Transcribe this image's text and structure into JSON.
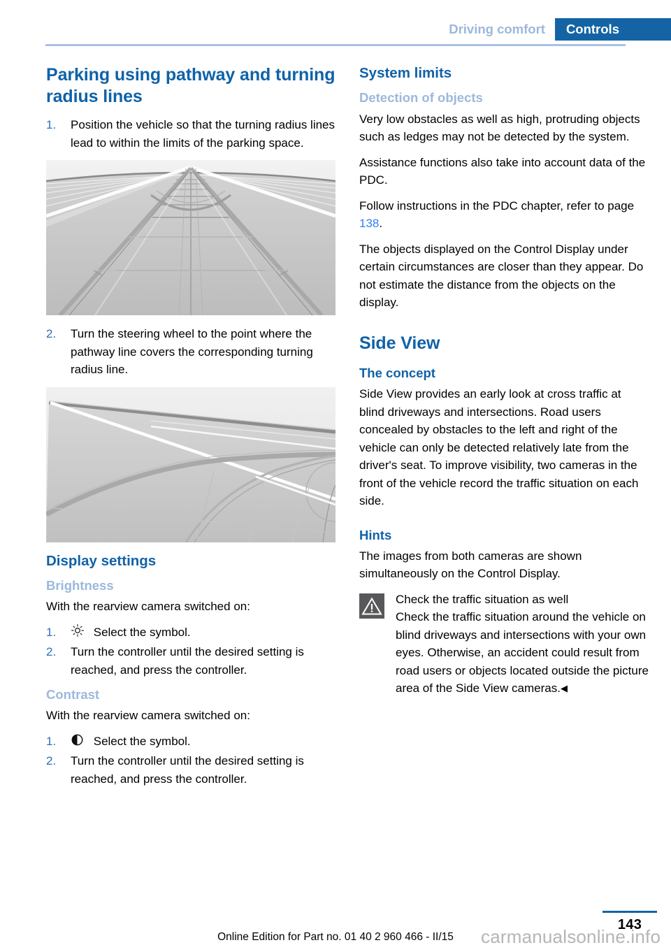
{
  "header": {
    "breadcrumb_inactive": "Driving comfort",
    "breadcrumb_active": "Controls",
    "accent_blue": "#1464a5",
    "light_blue": "#9db8dc"
  },
  "left_column": {
    "heading": "Parking using pathway and turning radius lines",
    "steps_parking": [
      {
        "num": "1.",
        "text": "Position the vehicle so that the turning radius lines lead to within the limits of the parking space."
      },
      {
        "num": "2.",
        "text": "Turn the steering wheel to the point where the pathway line covers the corresponding turning radius line."
      }
    ],
    "figure_one_alt": "Rearview camera view with pathway and turning radius lines converging to vanishing point",
    "figure_two_alt": "Rearview camera view with curved turning radius line over parking space markings",
    "display_settings_heading": "Display settings",
    "brightness": {
      "heading": "Brightness",
      "intro": "With the rearview camera switched on:",
      "steps": [
        {
          "num": "1.",
          "icon": "sun-icon",
          "text": "Select the symbol."
        },
        {
          "num": "2.",
          "icon": "",
          "text": "Turn the controller until the desired setting is reached, and press the controller."
        }
      ]
    },
    "contrast": {
      "heading": "Contrast",
      "intro": "With the rearview camera switched on:",
      "steps": [
        {
          "num": "1.",
          "icon": "half-circle-icon",
          "text": "Select the symbol."
        },
        {
          "num": "2.",
          "icon": "",
          "text": "Turn the controller until the desired setting is reached, and press the controller."
        }
      ]
    }
  },
  "right_column": {
    "system_limits_heading": "System limits",
    "detection_heading": "Detection of objects",
    "detection_paragraphs": [
      "Very low obstacles as well as high, protruding objects such as ledges may not be detected by the system.",
      "Assistance functions also take into account data of the PDC."
    ],
    "pdc_ref_prefix": "Follow instructions in the PDC chapter, refer to page ",
    "pdc_ref_page": "138",
    "pdc_ref_suffix": ".",
    "control_display_paragraph": "The objects displayed on the Control Display under certain circumstances are closer than they appear. Do not estimate the distance from the objects on the display.",
    "side_view_heading": "Side View",
    "concept_heading": "The concept",
    "concept_paragraph": "Side View provides an early look at cross traffic at blind driveways and intersections. Road users concealed by obstacles to the left and right of the vehicle can only be detected relatively late from the driver's seat. To improve visibility, two cameras in the front of the vehicle record the traffic situation on each side.",
    "hints_heading": "Hints",
    "hints_paragraph": "The images from both cameras are shown simultaneously on the Control Display.",
    "warning": {
      "icon": "warning-triangle-icon",
      "title": "Check the traffic situation as well",
      "body": "Check the traffic situation around the vehicle on blind driveways and intersections with your own eyes. Otherwise, an accident could result from road users or objects located outside the picture area of the Side View cameras.",
      "endmark": "◀"
    }
  },
  "footer": {
    "edition_text": "Online Edition for Part no. 01 40 2 960 466 - II/15",
    "page_number": "143",
    "watermark": "carmanualsonline.info"
  }
}
